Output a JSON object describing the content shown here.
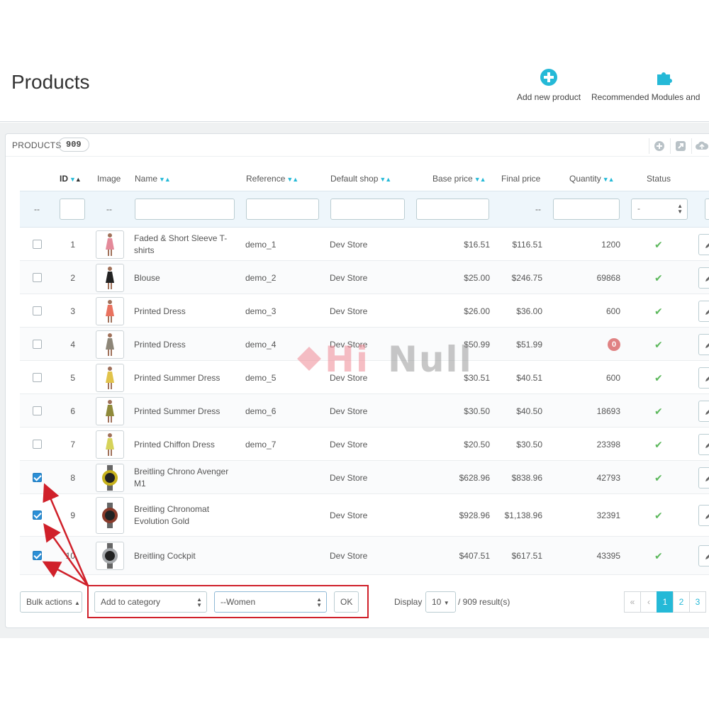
{
  "header": {
    "title": "Products",
    "toolbar": [
      {
        "label": "Add new product",
        "icon": "plus-circle-icon"
      },
      {
        "label": "Recommended Modules and",
        "icon": "puzzle-icon"
      }
    ]
  },
  "panel": {
    "title": "PRODUCTS",
    "count": "909",
    "head_icons": [
      "add-icon",
      "export-icon",
      "cloud-icon"
    ]
  },
  "table": {
    "columns": {
      "id": "ID",
      "image": "Image",
      "name": "Name",
      "reference": "Reference",
      "shop": "Default shop",
      "base_price": "Base price",
      "final_price": "Final price",
      "quantity": "Quantity",
      "status": "Status"
    },
    "filters": {
      "select_dash": "--",
      "image_dash": "--",
      "final_price_dash": "--",
      "status_select": "-"
    },
    "rows": [
      {
        "checked": false,
        "id": "1",
        "name": "Faded & Short Sleeve T-shirts",
        "reference": "demo_1",
        "shop": "Dev Store",
        "base_price": "$16.51",
        "final_price": "$116.51",
        "quantity": "1200",
        "status": "enabled",
        "image": "dress-pink"
      },
      {
        "checked": false,
        "id": "2",
        "name": "Blouse",
        "reference": "demo_2",
        "shop": "Dev Store",
        "base_price": "$25.00",
        "final_price": "$246.75",
        "quantity": "69868",
        "status": "enabled",
        "image": "blouse-black"
      },
      {
        "checked": false,
        "id": "3",
        "name": "Printed Dress",
        "reference": "demo_3",
        "shop": "Dev Store",
        "base_price": "$26.00",
        "final_price": "$36.00",
        "quantity": "600",
        "status": "enabled",
        "image": "dress-coral"
      },
      {
        "checked": false,
        "id": "4",
        "name": "Printed Dress",
        "reference": "demo_4",
        "shop": "Dev Store",
        "base_price": "$50.99",
        "final_price": "$51.99",
        "quantity": "0",
        "status": "enabled",
        "image": "dress-grey"
      },
      {
        "checked": false,
        "id": "5",
        "name": "Printed Summer Dress",
        "reference": "demo_5",
        "shop": "Dev Store",
        "base_price": "$30.51",
        "final_price": "$40.51",
        "quantity": "600",
        "status": "enabled",
        "image": "dress-yellow"
      },
      {
        "checked": false,
        "id": "6",
        "name": "Printed Summer Dress",
        "reference": "demo_6",
        "shop": "Dev Store",
        "base_price": "$30.50",
        "final_price": "$40.50",
        "quantity": "18693",
        "status": "enabled",
        "image": "dress-olive"
      },
      {
        "checked": false,
        "id": "7",
        "name": "Printed Chiffon Dress",
        "reference": "demo_7",
        "shop": "Dev Store",
        "base_price": "$20.50",
        "final_price": "$30.50",
        "quantity": "23398",
        "status": "enabled",
        "image": "dress-lime"
      },
      {
        "checked": true,
        "id": "8",
        "name": "Breitling Chrono Avenger M1",
        "reference": "",
        "shop": "Dev Store",
        "base_price": "$628.96",
        "final_price": "$838.96",
        "quantity": "42793",
        "status": "enabled",
        "image": "watch-yellow"
      },
      {
        "checked": true,
        "id": "9",
        "name": "Breitling Chronomat Evolution Gold",
        "reference": "",
        "shop": "Dev Store",
        "base_price": "$928.96",
        "final_price": "$1,138.96",
        "quantity": "32391",
        "status": "enabled",
        "image": "watch-gold"
      },
      {
        "checked": true,
        "id": "10",
        "name": "Breitling Cockpit",
        "reference": "",
        "shop": "Dev Store",
        "base_price": "$407.51",
        "final_price": "$617.51",
        "quantity": "43395",
        "status": "enabled",
        "image": "watch-silver"
      }
    ]
  },
  "footer": {
    "bulk_actions": "Bulk actions",
    "action_select": "Add to category",
    "category_select": "--Women",
    "ok": "OK",
    "display_label": "Display",
    "per_page": "10",
    "results": "/ 909 result(s)",
    "pages": [
      "1",
      "2",
      "3"
    ],
    "current_page": "1"
  },
  "watermark": {
    "part1": "Hi",
    "part2": "Null"
  },
  "colors": {
    "accent": "#25b9d7",
    "enabled": "#5cb85c",
    "zero_badge": "#e08283",
    "annotation": "#d0202a"
  }
}
